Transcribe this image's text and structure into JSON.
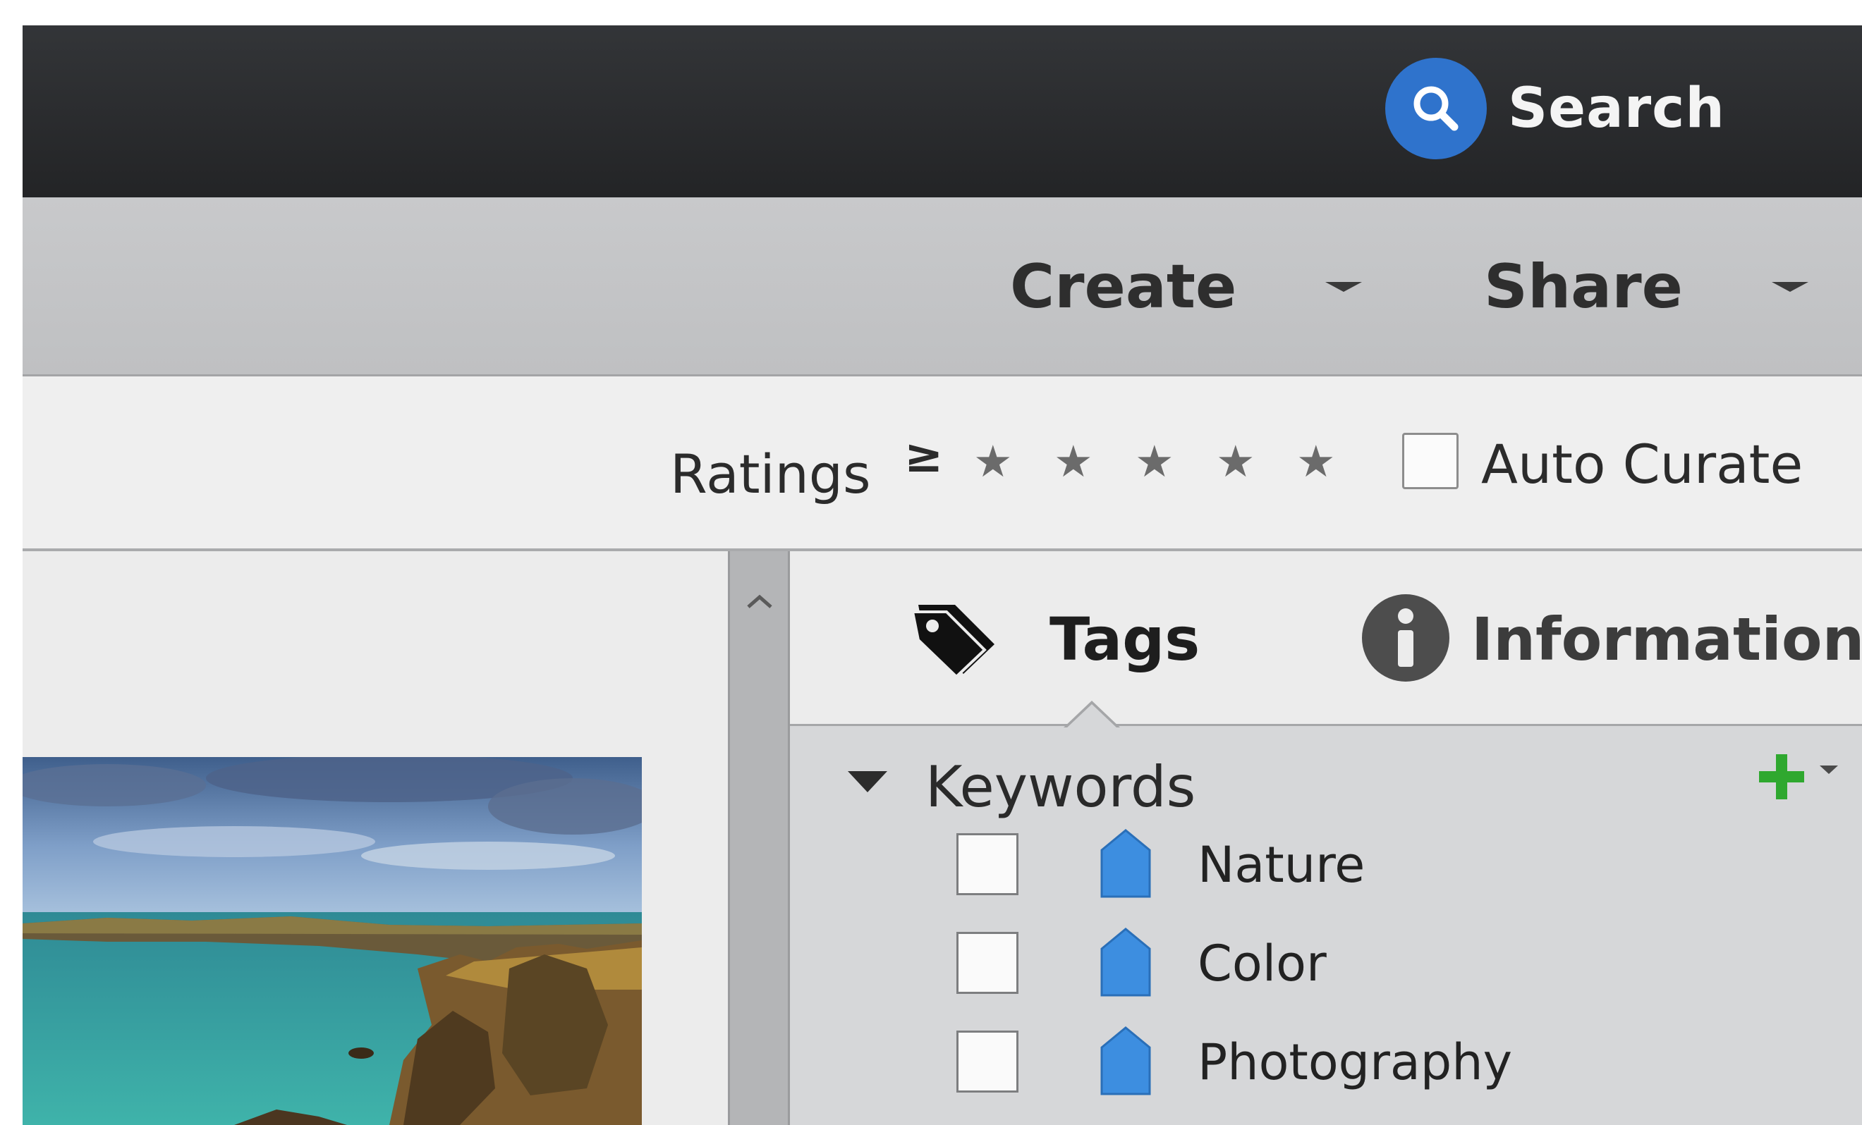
{
  "toolbar": {
    "search_label": "Search"
  },
  "actions": {
    "create_label": "Create",
    "share_label": "Share"
  },
  "filters": {
    "ratings_label": "Ratings",
    "ratings_operator": "≥",
    "stars_total": 5,
    "stars_selected": 0,
    "star_glyph": "★",
    "auto_curate_label": "Auto Curate",
    "auto_curate_checked": false
  },
  "panel": {
    "tabs": [
      {
        "label": "Tags",
        "icon": "tag-icon",
        "active": true
      },
      {
        "label": "Information",
        "icon": "info-icon",
        "active": false
      }
    ],
    "keywords": {
      "title": "Keywords",
      "expanded": true,
      "items": [
        {
          "label": "Nature",
          "checked": false
        },
        {
          "label": "Color",
          "checked": false
        },
        {
          "label": "Photography",
          "checked": false
        }
      ]
    }
  },
  "colors": {
    "search_blue": "#2f73cc",
    "tag_blue": "#3d8ee0",
    "add_green": "#2fa82f",
    "topbar": "#28292b"
  },
  "icons": {
    "search": "magnifier-icon",
    "add": "plus-icon",
    "scroll_up": "chevron-up-icon"
  }
}
